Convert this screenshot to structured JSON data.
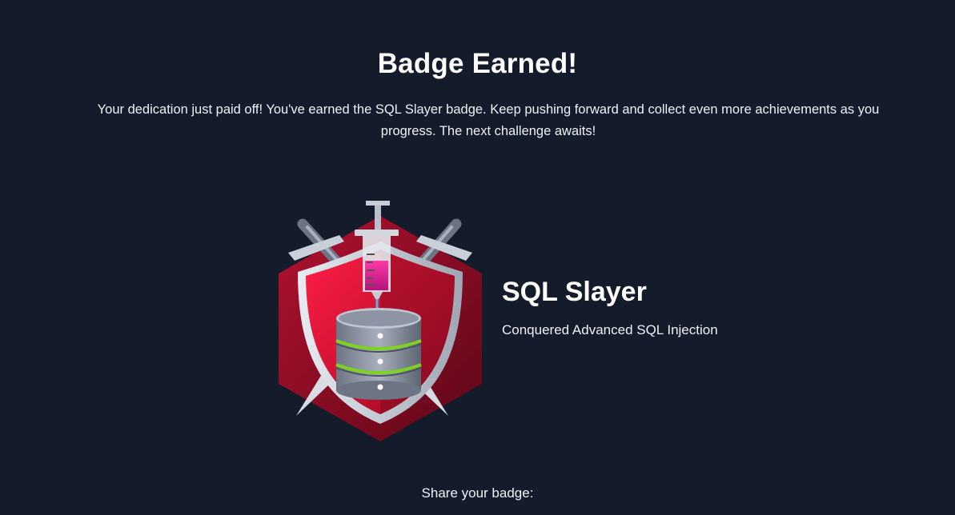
{
  "header": {
    "title": "Badge Earned!",
    "description": "Your dedication just paid off! You've earned the SQL Slayer badge. Keep pushing forward and collect even more achievements as you progress. The next challenge awaits!"
  },
  "badge": {
    "name": "SQL Slayer",
    "subtitle": "Conquered Advanced SQL Injection",
    "icon": "sql-slayer-badge-icon",
    "colors": {
      "hexagon": "#9b0f2a",
      "shield": "#e0153c",
      "database": "#8a93a3",
      "ring": "#7ed321",
      "syringe_fluid": "#e0209a"
    }
  },
  "share": {
    "label": "Share your badge:"
  }
}
